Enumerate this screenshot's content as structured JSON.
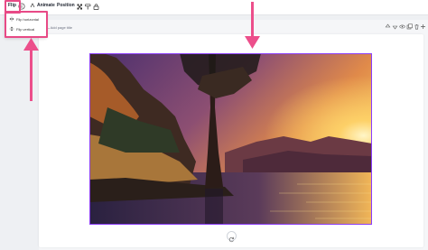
{
  "toolbar": {
    "flip_label": "Flip",
    "animate_label": "Animate",
    "position_label": "Position"
  },
  "flip_menu": {
    "items": [
      {
        "label": "Flip horizontal",
        "icon": "flip-horizontal-icon"
      },
      {
        "label": "Flip vertical",
        "icon": "flip-vertical-icon"
      }
    ]
  },
  "page": {
    "title_prefix": "4 -",
    "title_placeholder": "Add page title"
  },
  "colors": {
    "highlight": "#e84a86",
    "selection": "#8b3dff"
  }
}
